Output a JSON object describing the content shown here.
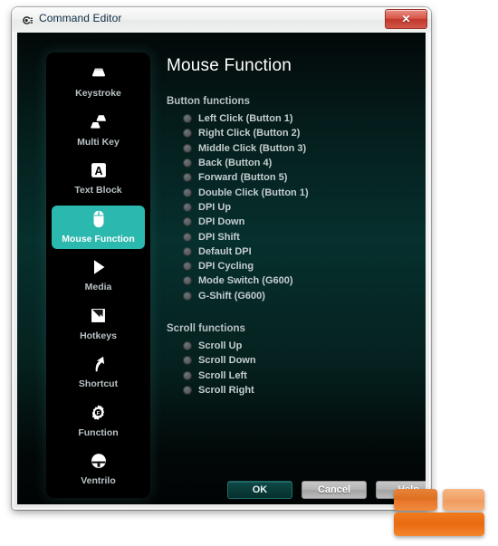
{
  "window": {
    "title": "Command Editor",
    "app_icon": "logitech-icon",
    "close_label": "✕"
  },
  "sidebar": {
    "items": [
      {
        "label": "Keystroke",
        "icon": "keycap-icon",
        "selected": false
      },
      {
        "label": "Multi Key",
        "icon": "multi-keycap-icon",
        "selected": false
      },
      {
        "label": "Text Block",
        "icon": "letter-a-icon",
        "selected": false
      },
      {
        "label": "Mouse Function",
        "icon": "mouse-icon",
        "selected": true
      },
      {
        "label": "Media",
        "icon": "play-triangle-icon",
        "selected": false
      },
      {
        "label": "Hotkeys",
        "icon": "lightning-page-icon",
        "selected": false
      },
      {
        "label": "Shortcut",
        "icon": "arrow-up-right-icon",
        "selected": false
      },
      {
        "label": "Function",
        "icon": "gear-icon",
        "selected": false
      },
      {
        "label": "Ventrilo",
        "icon": "headset-icon",
        "selected": false
      }
    ]
  },
  "main": {
    "title": "Mouse Function",
    "sections": [
      {
        "title": "Button functions",
        "options": [
          {
            "label": "Left Click (Button 1)",
            "selected": false
          },
          {
            "label": "Right Click (Button 2)",
            "selected": false
          },
          {
            "label": "Middle Click (Button 3)",
            "selected": false
          },
          {
            "label": "Back (Button 4)",
            "selected": false
          },
          {
            "label": "Forward (Button 5)",
            "selected": false
          },
          {
            "label": "Double Click (Button 1)",
            "selected": false
          },
          {
            "label": "DPI Up",
            "selected": false
          },
          {
            "label": "DPI Down",
            "selected": false
          },
          {
            "label": "DPI Shift",
            "selected": false
          },
          {
            "label": "Default DPI",
            "selected": false
          },
          {
            "label": "DPI Cycling",
            "selected": false
          },
          {
            "label": "Mode Switch (G600)",
            "selected": false
          },
          {
            "label": "G-Shift (G600)",
            "selected": false
          }
        ]
      },
      {
        "title": "Scroll functions",
        "options": [
          {
            "label": "Scroll Up",
            "selected": false
          },
          {
            "label": "Scroll Down",
            "selected": false
          },
          {
            "label": "Scroll Left",
            "selected": false
          },
          {
            "label": "Scroll Right",
            "selected": false
          }
        ]
      }
    ]
  },
  "footer": {
    "ok_label": "OK",
    "cancel_label": "Cancel",
    "help_label": "Help"
  },
  "colors": {
    "accent_teal": "#2bb8ae",
    "background_teal": "#06302d",
    "label_gray": "#c5cdd0",
    "logo_orange": "#e96b10",
    "close_red": "#c0392c"
  }
}
